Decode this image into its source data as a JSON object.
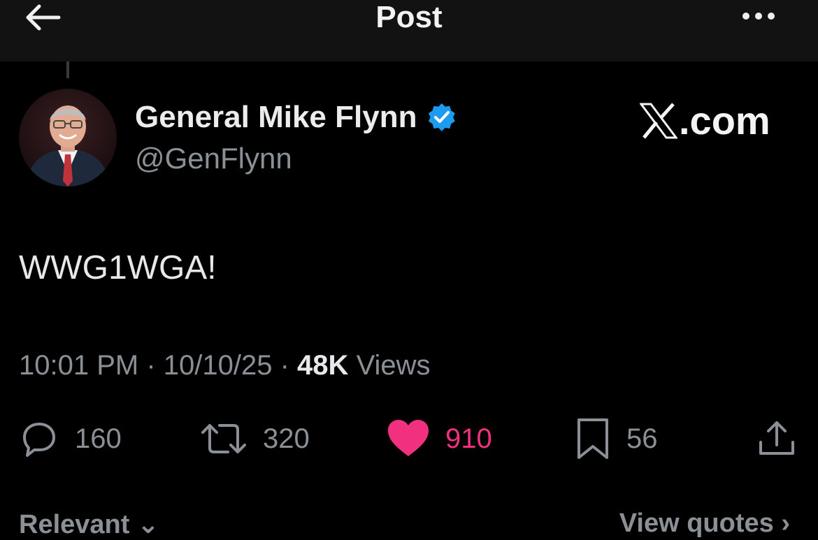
{
  "header": {
    "title": "Post",
    "back_icon": "arrow-left-icon",
    "more_icon": "more-horizontal-icon"
  },
  "author": {
    "display_name": "General Mike Flynn",
    "handle": "@GenFlynn",
    "verified": true,
    "verified_color": "#1d9bf0"
  },
  "watermark": {
    "text": ".com"
  },
  "post": {
    "text": "WWG1WGA!",
    "time": "10:01 PM",
    "date": "10/10/25",
    "views_count": "48K",
    "views_label": "Views"
  },
  "actions": {
    "replies": "160",
    "reposts": "320",
    "likes": "910",
    "bookmarks": "56",
    "liked": true,
    "like_color": "#f1307f"
  },
  "footer": {
    "relevant_label": "Relevant",
    "view_quotes_label": "View quotes"
  }
}
